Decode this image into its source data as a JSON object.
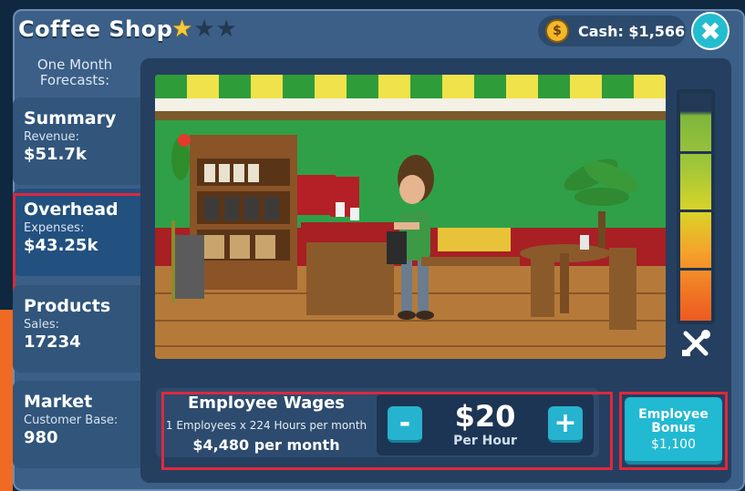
{
  "header": {
    "title": "Coffee Shop",
    "stars_filled": 1,
    "stars_total": 3,
    "cash": "Cash: $1,566",
    "coin_symbol": "$",
    "close_symbol": "✖"
  },
  "sidebar": {
    "forecast_label": "One Month Forecasts:",
    "tabs": [
      {
        "name": "Summary",
        "sublabel": "Revenue:",
        "value": "$51.7k"
      },
      {
        "name": "Overhead",
        "sublabel": "Expenses:",
        "value": "$43.25k"
      },
      {
        "name": "Products",
        "sublabel": "Sales:",
        "value": "17234"
      },
      {
        "name": "Market",
        "sublabel": "Customer Base:",
        "value": "980"
      }
    ]
  },
  "wages": {
    "title": "Employee Wages",
    "detail": "1 Employees x 224 Hours per month",
    "monthly": "$4,480 per month",
    "rate": "$20",
    "rate_unit": "Per Hour",
    "minus_label": "-",
    "plus_label": "+"
  },
  "bonus": {
    "label": "Employee Bonus",
    "amount": "$1,100"
  },
  "meter": {
    "level_fraction": 0.92
  },
  "colors": {
    "accent": "#22b9d2",
    "highlight": "#e0283c",
    "panel": "#3b5f87"
  }
}
